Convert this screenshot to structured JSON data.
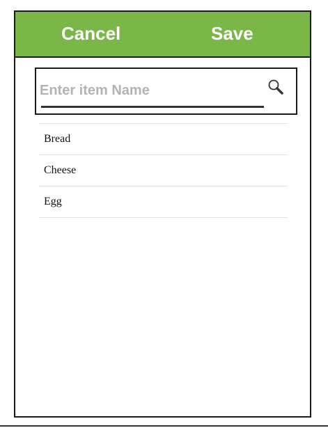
{
  "header": {
    "cancel_label": "Cancel",
    "save_label": "Save",
    "color": "#7ab648"
  },
  "search": {
    "placeholder": "Enter item Name",
    "value": "",
    "icon": "search-icon"
  },
  "items": [
    {
      "label": "Bread"
    },
    {
      "label": "Cheese"
    },
    {
      "label": "Egg"
    }
  ]
}
